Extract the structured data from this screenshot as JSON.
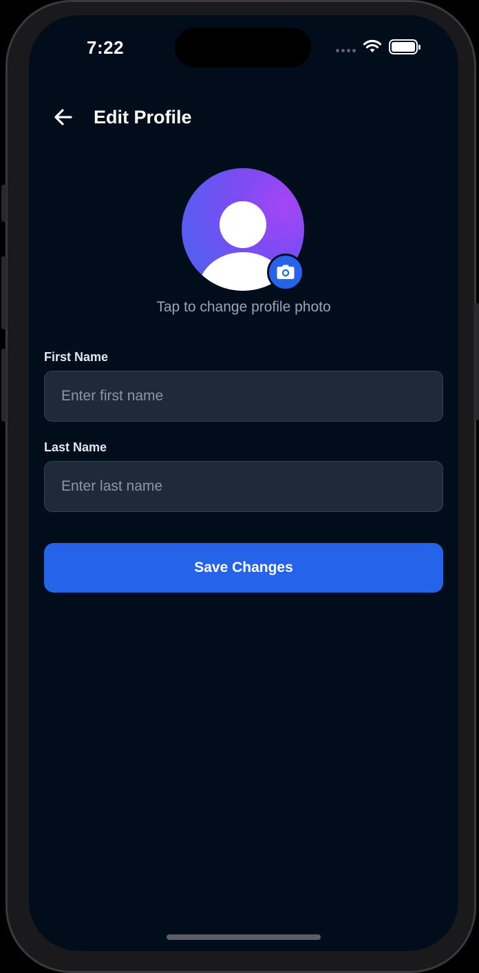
{
  "status_bar": {
    "time": "7:22"
  },
  "header": {
    "back_icon": "arrow-left-icon",
    "title": "Edit Profile"
  },
  "profile_photo": {
    "avatar_icon": "user-silhouette-icon",
    "camera_icon": "camera-icon",
    "hint": "Tap to change profile photo",
    "gradient_colors": [
      "#4c63ef",
      "#a446f5"
    ]
  },
  "form": {
    "first_name": {
      "label": "First Name",
      "value": "",
      "placeholder": "Enter first name"
    },
    "last_name": {
      "label": "Last Name",
      "value": "",
      "placeholder": "Enter last name"
    },
    "save_label": "Save Changes"
  },
  "colors": {
    "background": "#020d1b",
    "field_background": "#1f2937",
    "accent": "#2563eb"
  }
}
